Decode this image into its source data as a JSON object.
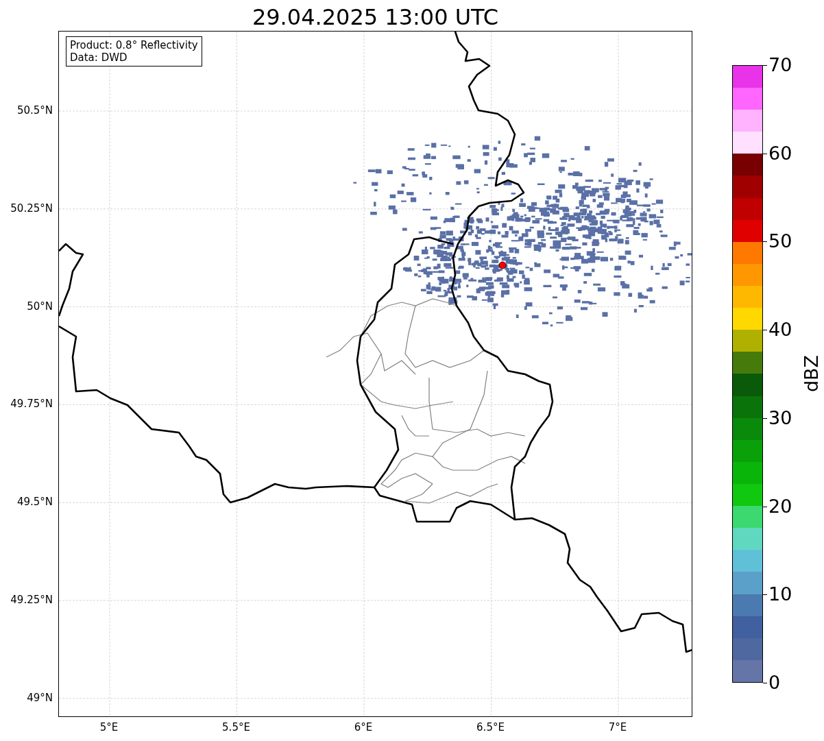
{
  "title": "29.04.2025 13:00 UTC",
  "info_box": [
    "Product: 0.8° Reflectivity",
    "Data: DWD"
  ],
  "y_ticks": [
    "50.5°N",
    "50.25°N",
    "50°N",
    "49.75°N",
    "49.5°N",
    "49.25°N",
    "49°N"
  ],
  "x_ticks": [
    "5°E",
    "5.5°E",
    "6°E",
    "6.5°E",
    "7°E"
  ],
  "colorbar": {
    "label": "dBZ",
    "ticks": [
      "70",
      "60",
      "50",
      "40",
      "30",
      "20",
      "10",
      "0"
    ],
    "bins": [
      {
        "color": "#6575a8"
      },
      {
        "color": "#5068a0"
      },
      {
        "color": "#4060a0"
      },
      {
        "color": "#4a7ab0"
      },
      {
        "color": "#5aa0c8"
      },
      {
        "color": "#60c0d8"
      },
      {
        "color": "#60d8c0"
      },
      {
        "color": "#3cd870"
      },
      {
        "color": "#10c810"
      },
      {
        "color": "#0ab50a"
      },
      {
        "color": "#0aa00a"
      },
      {
        "color": "#0a8a0a"
      },
      {
        "color": "#0a730a"
      },
      {
        "color": "#0a5a0a"
      },
      {
        "color": "#467a0a"
      },
      {
        "color": "#b0b000"
      },
      {
        "color": "#ffd800"
      },
      {
        "color": "#ffb800"
      },
      {
        "color": "#ff9800"
      },
      {
        "color": "#ff7800"
      },
      {
        "color": "#e00000"
      },
      {
        "color": "#c00000"
      },
      {
        "color": "#a00000"
      },
      {
        "color": "#780000"
      },
      {
        "color": "#ffe0ff"
      },
      {
        "color": "#ffb3ff"
      },
      {
        "color": "#ff66ff"
      },
      {
        "color": "#e833e8"
      }
    ]
  }
}
